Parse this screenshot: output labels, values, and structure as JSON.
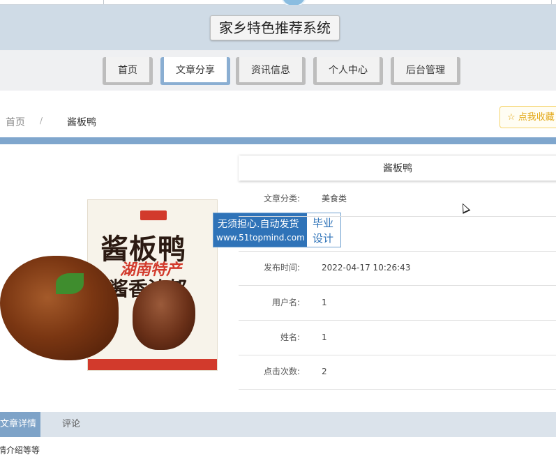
{
  "header": {
    "title": "家乡特色推荐系统"
  },
  "nav": {
    "items": [
      {
        "label": "首页"
      },
      {
        "label": "文章分享"
      },
      {
        "label": "资讯信息"
      },
      {
        "label": "个人中心"
      },
      {
        "label": "后台管理"
      }
    ],
    "active": "文章分享"
  },
  "breadcrumb": {
    "home": "首页",
    "separator": "/",
    "current": "酱板鸭"
  },
  "favorite": {
    "icon": "star-outline-icon",
    "label": "☆ 点我收藏"
  },
  "product": {
    "image_text_main": "酱板鸭",
    "image_text_sub": "湖南特产",
    "image_text_tag": "酱香浓郁"
  },
  "watermark": {
    "line1": "无须担心.自动发货",
    "line2": "www.51topmind.com",
    "right1": "毕业",
    "right2": "设计"
  },
  "detail": {
    "title": "酱板鸭",
    "rows": [
      {
        "label": "文章分类:",
        "value": "美食类"
      },
      {
        "label": "",
        "value": ""
      },
      {
        "label": "发布时间:",
        "value": "2022-04-17 10:26:43"
      },
      {
        "label": "用户名:",
        "value": "1"
      },
      {
        "label": "姓名:",
        "value": "1"
      },
      {
        "label": "点击次数:",
        "value": "2"
      }
    ]
  },
  "tabs": [
    {
      "label": "文章详情"
    },
    {
      "label": "评论"
    }
  ],
  "content": {
    "text": "情介绍等等"
  },
  "colors": {
    "header_bg": "#cfdbe6",
    "accent": "#7fa6cd",
    "favorite": "#e3a817"
  }
}
